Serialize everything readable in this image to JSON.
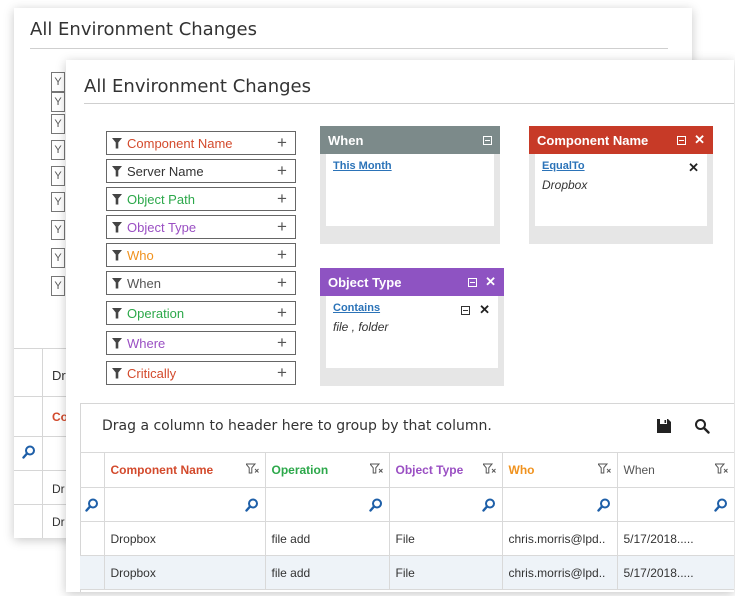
{
  "back_panel": {
    "title": "All Environment Changes",
    "chips": [
      "Y",
      "Y",
      "Y",
      "Y",
      "Y",
      "Y",
      "Y",
      "Y",
      "Y"
    ],
    "group_text_fragment": "Dr",
    "header_fragment": "Co",
    "row_fragments": [
      "Dr",
      "Dr"
    ]
  },
  "front_panel": {
    "title": "All Environment Changes",
    "filter_fields": [
      {
        "label": "Component Name",
        "color": "#d34a2c"
      },
      {
        "label": "Server Name",
        "color": "#333333"
      },
      {
        "label": "Object Path",
        "color": "#2ca84a"
      },
      {
        "label": "Object Type",
        "color": "#9a4fc3"
      },
      {
        "label": "Who",
        "color": "#f0921e"
      },
      {
        "label": "When",
        "color": "#555555"
      },
      {
        "label": "Operation",
        "color": "#2ca84a"
      },
      {
        "label": "Where",
        "color": "#9a4fc3"
      },
      {
        "label": "Critically",
        "color": "#d34a2c"
      }
    ],
    "add_glyph": "+",
    "cards": {
      "when": {
        "title": "When",
        "color": "#7c8a8a",
        "condition": "This Month",
        "value": ""
      },
      "component_name": {
        "title": "Component Name",
        "color": "#c73a27",
        "condition": "EqualTo",
        "value": "Dropbox"
      },
      "object_type": {
        "title": "Object Type",
        "color": "#8e53c2",
        "condition": "Contains",
        "value": "file , folder"
      }
    },
    "close_glyph": "✕",
    "body_close_glyph": "✕",
    "grid": {
      "group_hint": "Drag a column to header here to group by that column.",
      "columns": [
        {
          "label": "Component Name",
          "color": "#d34a2c"
        },
        {
          "label": "Operation",
          "color": "#2ca84a"
        },
        {
          "label": "Object Type",
          "color": "#9a4fc3"
        },
        {
          "label": "Who",
          "color": "#f0921e"
        },
        {
          "label": "When",
          "color": "#555555"
        }
      ],
      "rows": [
        [
          "Dropbox",
          "file add",
          "File",
          "chris.morris@lpd..",
          "5/17/2018....."
        ],
        [
          "Dropbox",
          "file add",
          "File",
          "chris.morris@lpd..",
          "5/17/2018....."
        ]
      ]
    }
  },
  "icons": {
    "filter": "funnel-icon",
    "search": "search-icon",
    "save": "save-icon",
    "close": "close-icon",
    "minimize": "minimize-icon",
    "add": "plus-icon"
  },
  "accent_link_color": "#2b73b8",
  "search_icon_color": "#1e5fa8"
}
